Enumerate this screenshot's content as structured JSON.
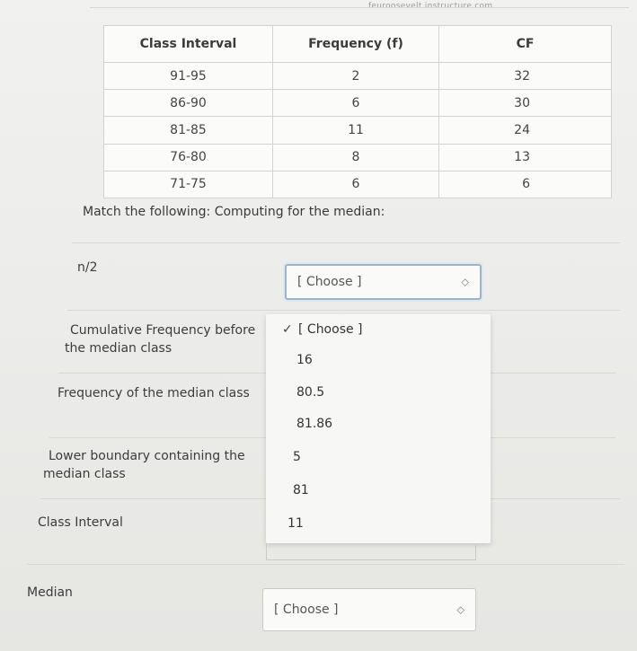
{
  "header": {
    "url": "feuroosevelt.instructure.com"
  },
  "table": {
    "headers": [
      "Class Interval",
      "Frequency (f)",
      "CF"
    ],
    "rows": [
      [
        "91-95",
        "2",
        "32"
      ],
      [
        "86-90",
        "6",
        "30"
      ],
      [
        "81-85",
        "11",
        "24"
      ],
      [
        "76-80",
        "8",
        "13"
      ],
      [
        "71-75",
        "6",
        "6"
      ]
    ]
  },
  "instruction": "Match the following: Computing for the median:",
  "items": {
    "n_half": {
      "label": "n/2",
      "select_value": "[ Choose ]"
    },
    "cum_freq_before": {
      "label_line1": "Cumulative Frequency before",
      "label_line2": "the median class"
    },
    "freq_median_class": {
      "label": "Frequency of the median class"
    },
    "lower_boundary": {
      "label_line1": "Lower boundary containing the",
      "label_line2": "median class"
    },
    "class_interval": {
      "label": "Class Interval"
    },
    "median": {
      "label": "Median",
      "select_value": "[ Choose ]"
    }
  },
  "dropdown": {
    "check_mark": "✓",
    "options": [
      "[ Choose ]",
      "16",
      "80.5",
      "81.86",
      "5",
      "81",
      "11"
    ]
  },
  "icons": {
    "select_chevron": "⌃⌄"
  }
}
